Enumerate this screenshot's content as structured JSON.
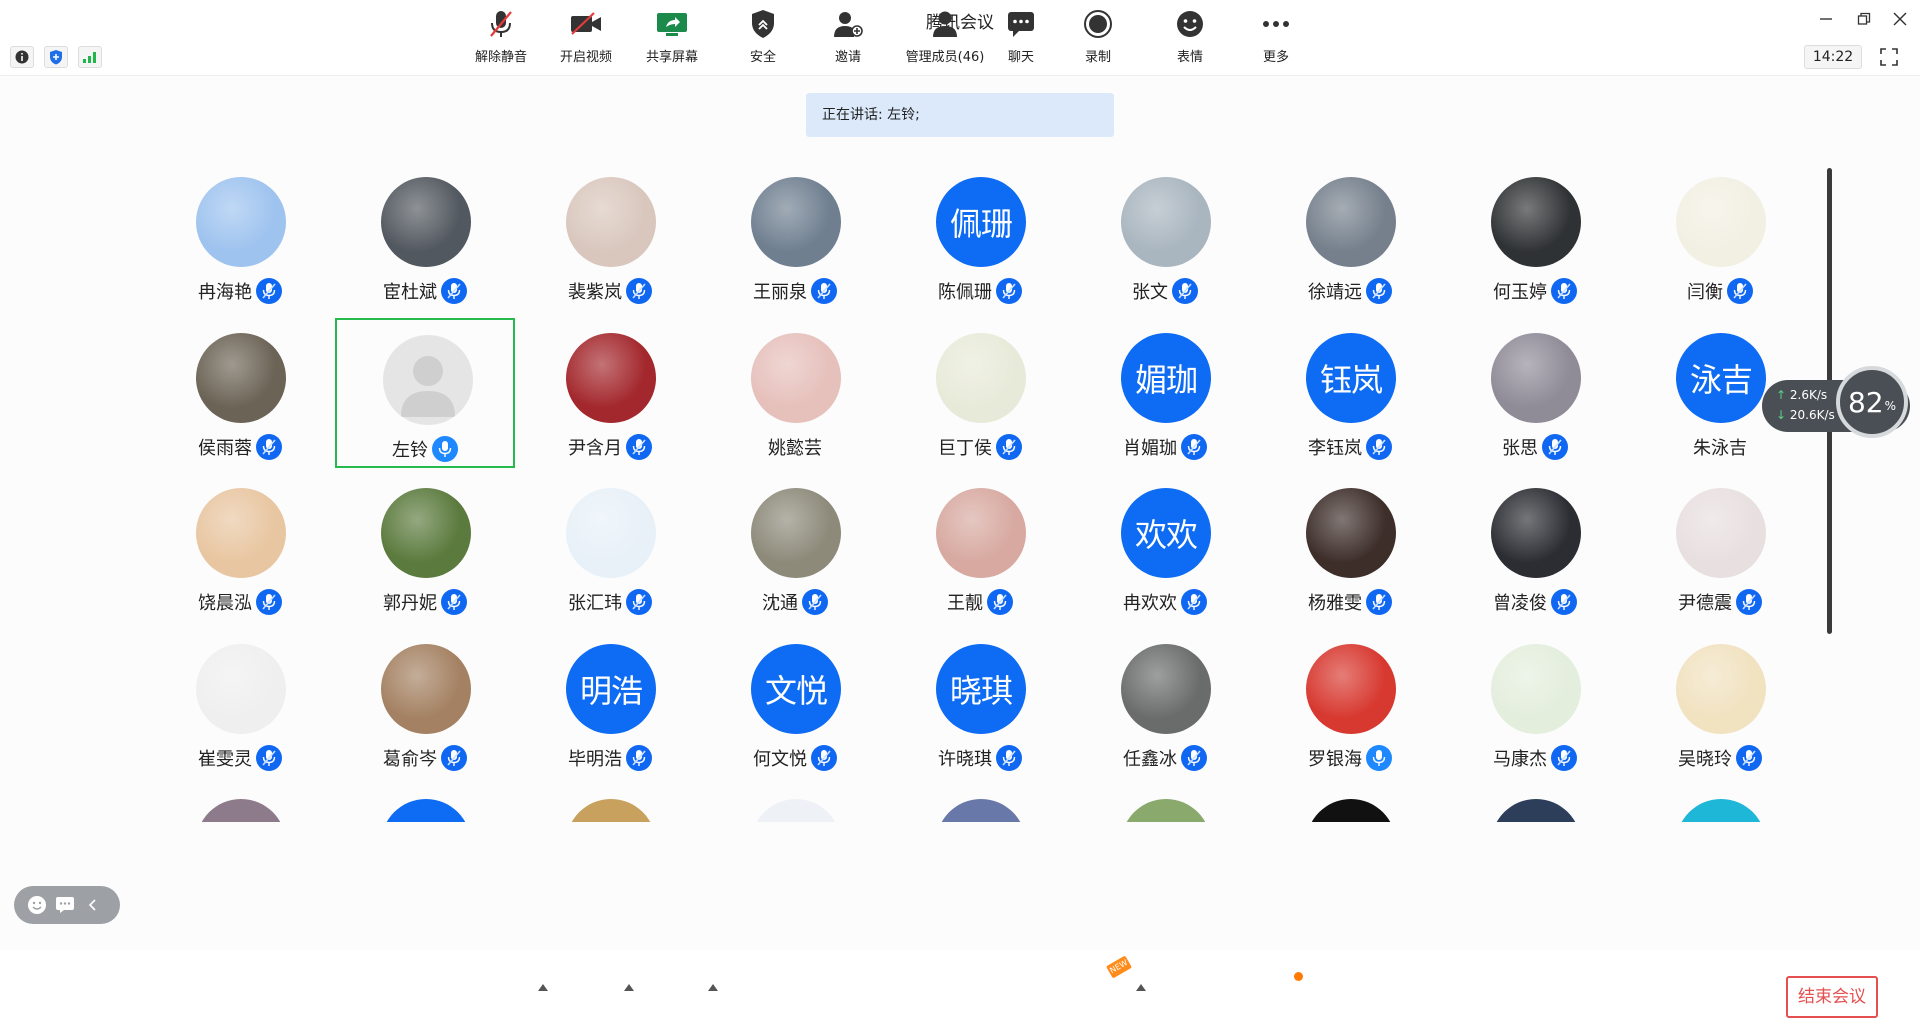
{
  "window": {
    "title": "腾讯会议"
  },
  "infobar": {
    "clock": "14:22"
  },
  "speaking": {
    "text": "正在讲话: 左铃;"
  },
  "network": {
    "up": "2.6K/s",
    "down": "20.6K/s",
    "cpu_percent": "82",
    "cpu_unit": "%"
  },
  "participants": [
    {
      "name": "冉海艳",
      "avatar": "img",
      "color": "#9ec3ef"
    },
    {
      "name": "宦杜斌",
      "avatar": "img",
      "color": "#52585f"
    },
    {
      "name": "裴紫岚",
      "avatar": "img",
      "color": "#d9c7bd"
    },
    {
      "name": "王丽泉",
      "avatar": "img",
      "color": "#6f7f90"
    },
    {
      "name": "陈佩珊",
      "avatar": "text",
      "text": "佩珊"
    },
    {
      "name": "张文",
      "avatar": "img",
      "color": "#a9b5bf"
    },
    {
      "name": "徐靖远",
      "avatar": "img",
      "color": "#75808c"
    },
    {
      "name": "何玉婷",
      "avatar": "img",
      "color": "#2f3234"
    },
    {
      "name": "闫衡",
      "avatar": "img",
      "color": "#f2f0e3"
    },
    {
      "name": "侯雨蓉",
      "avatar": "img",
      "color": "#6b6355"
    },
    {
      "name": "左铃",
      "avatar": "default",
      "color": "#e5e5e5",
      "selected": true,
      "mic_active": true
    },
    {
      "name": "尹含月",
      "avatar": "img",
      "color": "#a3282d"
    },
    {
      "name": "姚懿芸",
      "avatar": "img",
      "color": "#e6c0bb",
      "nomic": true
    },
    {
      "name": "巨丁侯",
      "avatar": "img",
      "color": "#e8ead9"
    },
    {
      "name": "肖媚珈",
      "avatar": "text",
      "text": "媚珈"
    },
    {
      "name": "李钰岚",
      "avatar": "text",
      "text": "钰岚"
    },
    {
      "name": "张思",
      "avatar": "img",
      "color": "#8f8b97"
    },
    {
      "name": "朱泳吉",
      "avatar": "text",
      "text": "泳吉",
      "nomic": true
    },
    {
      "name": "饶晨泓",
      "avatar": "img",
      "color": "#e8c6a1"
    },
    {
      "name": "郭丹妮",
      "avatar": "img",
      "color": "#5b7a3d"
    },
    {
      "name": "张汇玮",
      "avatar": "img",
      "color": "#e8f1f8"
    },
    {
      "name": "沈通",
      "avatar": "img",
      "color": "#8d8a7a"
    },
    {
      "name": "王靓",
      "avatar": "img",
      "color": "#d7a9a0",
      "nomic_arrow": true
    },
    {
      "name": "冉欢欢",
      "avatar": "text",
      "text": "欢欢"
    },
    {
      "name": "杨雅雯",
      "avatar": "img",
      "color": "#3d2e2a"
    },
    {
      "name": "曾凌俊",
      "avatar": "img",
      "color": "#2b2d33"
    },
    {
      "name": "尹德震",
      "avatar": "img",
      "color": "#e8dfe0"
    },
    {
      "name": "崔雯灵",
      "avatar": "img",
      "color": "#efefef"
    },
    {
      "name": "葛俞岑",
      "avatar": "img",
      "color": "#a48162"
    },
    {
      "name": "毕明浩",
      "avatar": "text",
      "text": "明浩"
    },
    {
      "name": "何文悦",
      "avatar": "text",
      "text": "文悦"
    },
    {
      "name": "许晓琪",
      "avatar": "text",
      "text": "晓琪"
    },
    {
      "name": "任鑫冰",
      "avatar": "img",
      "color": "#6a6c6b"
    },
    {
      "name": "罗银海",
      "avatar": "img",
      "color": "#d7382f",
      "mic_active": true
    },
    {
      "name": "马康杰",
      "avatar": "img",
      "color": "#e4eedd"
    },
    {
      "name": "吴晓玲",
      "avatar": "img",
      "color": "#f1e2c0"
    }
  ],
  "partial_row": [
    "#8d7a8b",
    "#0d6bf4",
    "#c8a15f",
    "#eef2f7",
    "#6878a8",
    "#8aa96c",
    "#111111",
    "#2c3e5a",
    "#1fb7d8"
  ],
  "toolbar": {
    "unmute": "解除静音",
    "video": "开启视频",
    "share": "共享屏幕",
    "security": "安全",
    "invite": "邀请",
    "members": "管理成员(46)",
    "chat": "聊天",
    "record": "录制",
    "reactions": "表情",
    "more": "更多",
    "new_badge": "NEW",
    "end": "结束会议"
  }
}
